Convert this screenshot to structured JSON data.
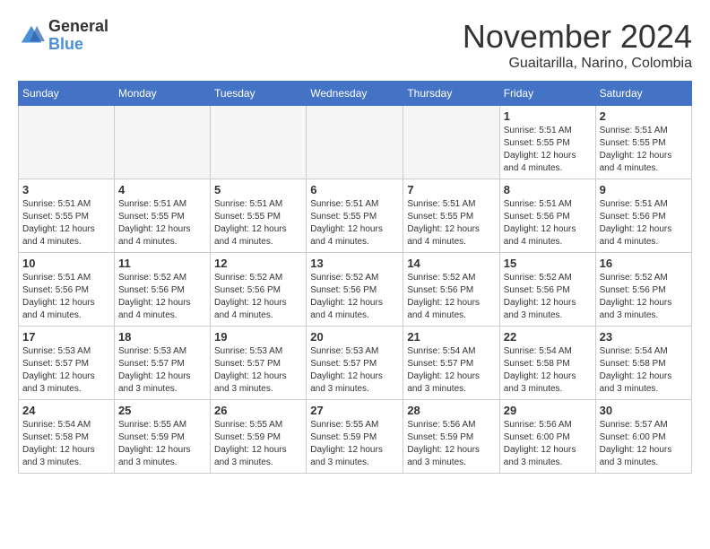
{
  "header": {
    "logo_general": "General",
    "logo_blue": "Blue",
    "month_title": "November 2024",
    "subtitle": "Guaitarilla, Narino, Colombia"
  },
  "days_of_week": [
    "Sunday",
    "Monday",
    "Tuesday",
    "Wednesday",
    "Thursday",
    "Friday",
    "Saturday"
  ],
  "weeks": [
    [
      {
        "day": "",
        "info": ""
      },
      {
        "day": "",
        "info": ""
      },
      {
        "day": "",
        "info": ""
      },
      {
        "day": "",
        "info": ""
      },
      {
        "day": "",
        "info": ""
      },
      {
        "day": "1",
        "info": "Sunrise: 5:51 AM\nSunset: 5:55 PM\nDaylight: 12 hours and 4 minutes."
      },
      {
        "day": "2",
        "info": "Sunrise: 5:51 AM\nSunset: 5:55 PM\nDaylight: 12 hours and 4 minutes."
      }
    ],
    [
      {
        "day": "3",
        "info": "Sunrise: 5:51 AM\nSunset: 5:55 PM\nDaylight: 12 hours and 4 minutes."
      },
      {
        "day": "4",
        "info": "Sunrise: 5:51 AM\nSunset: 5:55 PM\nDaylight: 12 hours and 4 minutes."
      },
      {
        "day": "5",
        "info": "Sunrise: 5:51 AM\nSunset: 5:55 PM\nDaylight: 12 hours and 4 minutes."
      },
      {
        "day": "6",
        "info": "Sunrise: 5:51 AM\nSunset: 5:55 PM\nDaylight: 12 hours and 4 minutes."
      },
      {
        "day": "7",
        "info": "Sunrise: 5:51 AM\nSunset: 5:55 PM\nDaylight: 12 hours and 4 minutes."
      },
      {
        "day": "8",
        "info": "Sunrise: 5:51 AM\nSunset: 5:56 PM\nDaylight: 12 hours and 4 minutes."
      },
      {
        "day": "9",
        "info": "Sunrise: 5:51 AM\nSunset: 5:56 PM\nDaylight: 12 hours and 4 minutes."
      }
    ],
    [
      {
        "day": "10",
        "info": "Sunrise: 5:51 AM\nSunset: 5:56 PM\nDaylight: 12 hours and 4 minutes."
      },
      {
        "day": "11",
        "info": "Sunrise: 5:52 AM\nSunset: 5:56 PM\nDaylight: 12 hours and 4 minutes."
      },
      {
        "day": "12",
        "info": "Sunrise: 5:52 AM\nSunset: 5:56 PM\nDaylight: 12 hours and 4 minutes."
      },
      {
        "day": "13",
        "info": "Sunrise: 5:52 AM\nSunset: 5:56 PM\nDaylight: 12 hours and 4 minutes."
      },
      {
        "day": "14",
        "info": "Sunrise: 5:52 AM\nSunset: 5:56 PM\nDaylight: 12 hours and 4 minutes."
      },
      {
        "day": "15",
        "info": "Sunrise: 5:52 AM\nSunset: 5:56 PM\nDaylight: 12 hours and 3 minutes."
      },
      {
        "day": "16",
        "info": "Sunrise: 5:52 AM\nSunset: 5:56 PM\nDaylight: 12 hours and 3 minutes."
      }
    ],
    [
      {
        "day": "17",
        "info": "Sunrise: 5:53 AM\nSunset: 5:57 PM\nDaylight: 12 hours and 3 minutes."
      },
      {
        "day": "18",
        "info": "Sunrise: 5:53 AM\nSunset: 5:57 PM\nDaylight: 12 hours and 3 minutes."
      },
      {
        "day": "19",
        "info": "Sunrise: 5:53 AM\nSunset: 5:57 PM\nDaylight: 12 hours and 3 minutes."
      },
      {
        "day": "20",
        "info": "Sunrise: 5:53 AM\nSunset: 5:57 PM\nDaylight: 12 hours and 3 minutes."
      },
      {
        "day": "21",
        "info": "Sunrise: 5:54 AM\nSunset: 5:57 PM\nDaylight: 12 hours and 3 minutes."
      },
      {
        "day": "22",
        "info": "Sunrise: 5:54 AM\nSunset: 5:58 PM\nDaylight: 12 hours and 3 minutes."
      },
      {
        "day": "23",
        "info": "Sunrise: 5:54 AM\nSunset: 5:58 PM\nDaylight: 12 hours and 3 minutes."
      }
    ],
    [
      {
        "day": "24",
        "info": "Sunrise: 5:54 AM\nSunset: 5:58 PM\nDaylight: 12 hours and 3 minutes."
      },
      {
        "day": "25",
        "info": "Sunrise: 5:55 AM\nSunset: 5:59 PM\nDaylight: 12 hours and 3 minutes."
      },
      {
        "day": "26",
        "info": "Sunrise: 5:55 AM\nSunset: 5:59 PM\nDaylight: 12 hours and 3 minutes."
      },
      {
        "day": "27",
        "info": "Sunrise: 5:55 AM\nSunset: 5:59 PM\nDaylight: 12 hours and 3 minutes."
      },
      {
        "day": "28",
        "info": "Sunrise: 5:56 AM\nSunset: 5:59 PM\nDaylight: 12 hours and 3 minutes."
      },
      {
        "day": "29",
        "info": "Sunrise: 5:56 AM\nSunset: 6:00 PM\nDaylight: 12 hours and 3 minutes."
      },
      {
        "day": "30",
        "info": "Sunrise: 5:57 AM\nSunset: 6:00 PM\nDaylight: 12 hours and 3 minutes."
      }
    ]
  ]
}
